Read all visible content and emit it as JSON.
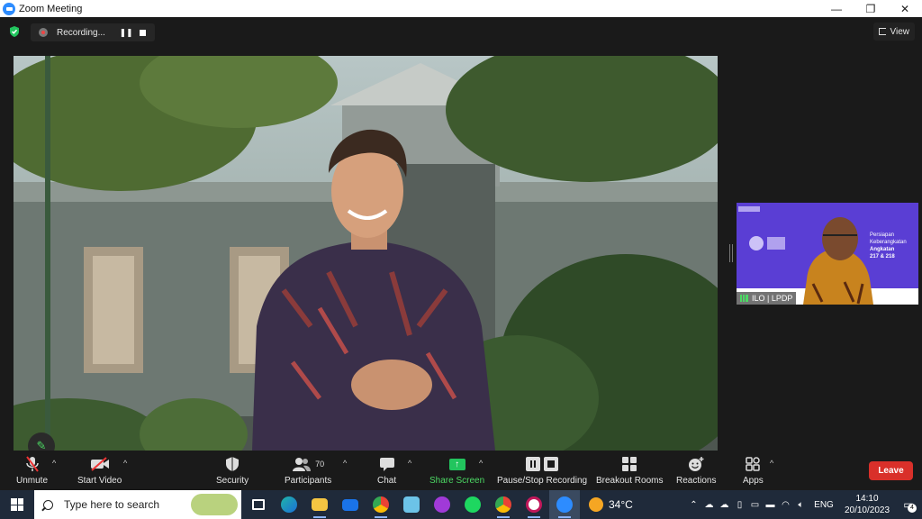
{
  "window": {
    "title": "Zoom Meeting",
    "minimize": "—",
    "restore": "❐",
    "close": "✕"
  },
  "meeting_top": {
    "recording_label": "Recording...",
    "pause_icon": "❚❚",
    "view_label": "View"
  },
  "thumbnail": {
    "participant_name": "ILO | LPDP",
    "slide_text_1": "Persiapan",
    "slide_text_2": "Keberangkatan",
    "slide_text_3": "Angkatan",
    "slide_text_4": "217 & 218"
  },
  "toolbar": {
    "unmute": "Unmute",
    "start_video": "Start Video",
    "security": "Security",
    "participants": "Participants",
    "participants_count": "70",
    "chat": "Chat",
    "share_screen": "Share Screen",
    "pause_stop_recording": "Pause/Stop Recording",
    "breakout_rooms": "Breakout Rooms",
    "reactions": "Reactions",
    "apps": "Apps",
    "leave": "Leave",
    "caret": "^"
  },
  "taskbar": {
    "search_placeholder": "Type here to search",
    "temperature": "34°C",
    "language": "ENG",
    "time": "14:10",
    "date": "20/10/2023",
    "notification_count": "4"
  },
  "colors": {
    "accent_green": "#4cd964",
    "leave_red": "#d9302a",
    "zoom_blue": "#2d8cff",
    "thumbnail_purple": "#5a3ed4"
  }
}
